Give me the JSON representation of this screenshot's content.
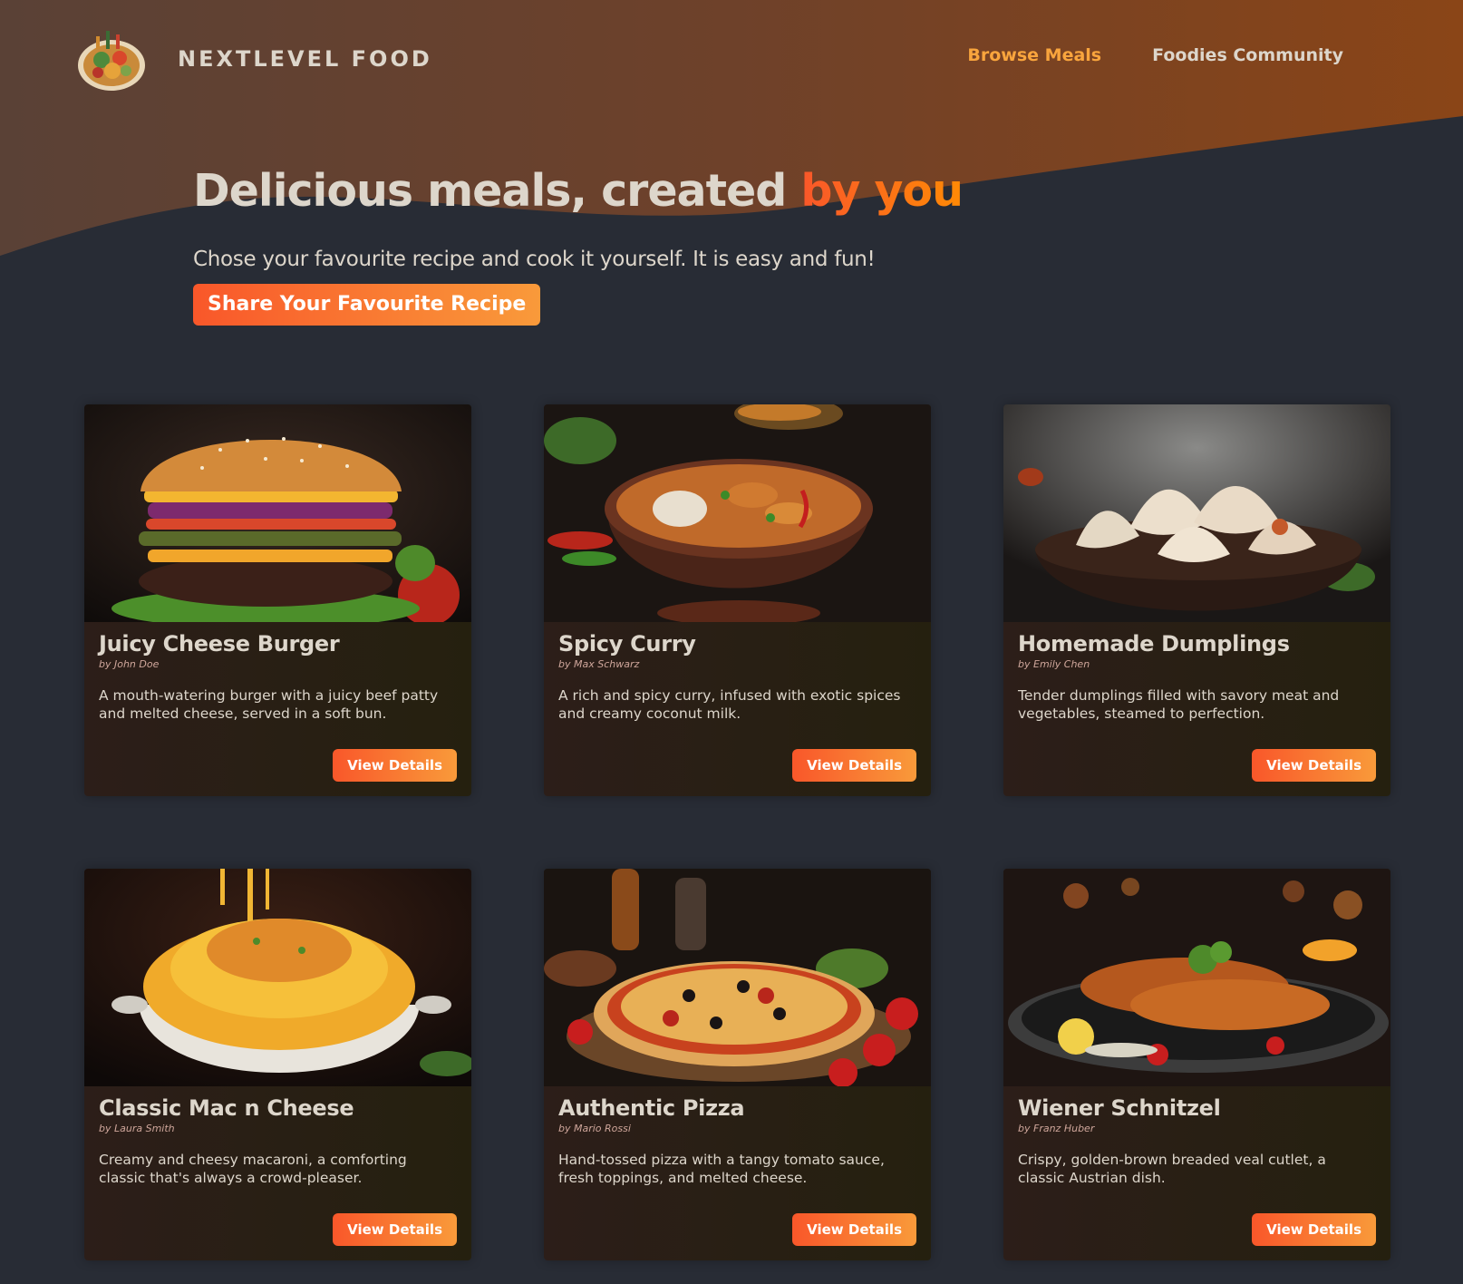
{
  "header": {
    "logo_text": "NextLevel Food",
    "nav": [
      {
        "label": "Browse Meals",
        "active": true
      },
      {
        "label": "Foodies Community",
        "active": false
      }
    ]
  },
  "hero": {
    "title_prefix": "Delicious meals, created ",
    "title_highlight": "by you",
    "subtitle": "Chose your favourite recipe and cook it yourself. It is easy and fun!",
    "cta_label": "Share Your Favourite Recipe"
  },
  "meals": [
    {
      "title": "Juicy Cheese Burger",
      "author": "by John Doe",
      "summary": "A mouth-watering burger with a juicy beef patty and melted cheese, served in a soft bun.",
      "button": "View Details",
      "image": "burger-photo"
    },
    {
      "title": "Spicy Curry",
      "author": "by Max Schwarz",
      "summary": "A rich and spicy curry, infused with exotic spices and creamy coconut milk.",
      "button": "View Details",
      "image": "curry-photo"
    },
    {
      "title": "Homemade Dumplings",
      "author": "by Emily Chen",
      "summary": "Tender dumplings filled with savory meat and vegetables, steamed to perfection.",
      "button": "View Details",
      "image": "dumplings-photo"
    },
    {
      "title": "Classic Mac n Cheese",
      "author": "by Laura Smith",
      "summary": "Creamy and cheesy macaroni, a comforting classic that's always a crowd-pleaser.",
      "button": "View Details",
      "image": "mac-n-cheese-photo"
    },
    {
      "title": "Authentic Pizza",
      "author": "by Mario Rossi",
      "summary": "Hand-tossed pizza with a tangy tomato sauce, fresh toppings, and melted cheese.",
      "button": "View Details",
      "image": "pizza-photo"
    },
    {
      "title": "Wiener Schnitzel",
      "author": "by Franz Huber",
      "summary": "Crispy, golden-brown breaded veal cutlet, a classic Austrian dish.",
      "button": "View Details",
      "image": "schnitzel-photo"
    }
  ],
  "colors": {
    "background": "#282c35",
    "accent": "#f9572a",
    "accent_light": "#f99a3a",
    "nav_active": "#f9a53d",
    "text": "#ddd6cb"
  }
}
